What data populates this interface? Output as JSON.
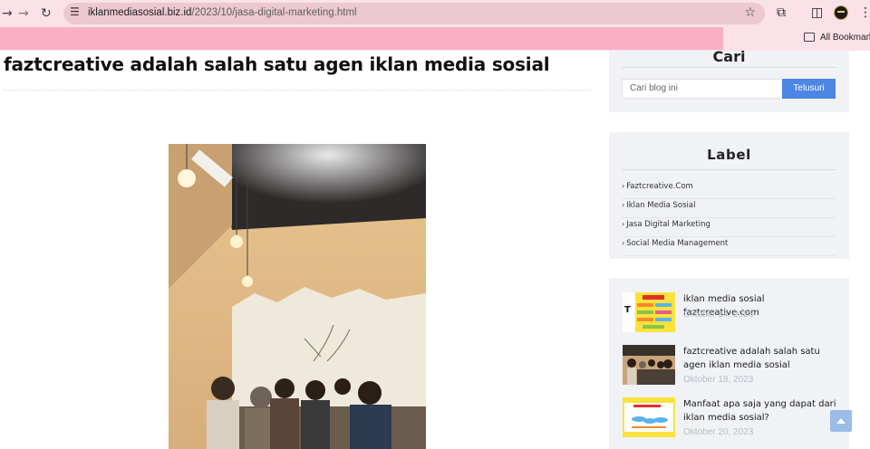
{
  "browser": {
    "url_host": "iklanmediasosial.biz.id",
    "url_path": "/2023/10/jasa-digital-marketing.html",
    "bookmarks_label": "All Bookmarks",
    "accent_banner_color": "#f9b0c6"
  },
  "post": {
    "title": "faztcreative adalah salah satu agen iklan media sosial"
  },
  "sidebar": {
    "search": {
      "title": "Cari",
      "placeholder": "Cari blog ini",
      "button_label": "Telusuri",
      "button_color": "#4d86e3"
    },
    "labels": {
      "title": "Label",
      "items": [
        "Faztcreative.Com",
        "Iklan Media Sosial",
        "Jasa Digital Marketing",
        "Social Media Management"
      ]
    },
    "popular_posts": [
      {
        "title": "iklan media sosial faztcreative.com",
        "date": "Oktober 14, 2023",
        "thumb": "infographic-thumbnail"
      },
      {
        "title": "faztcreative adalah salah satu agen iklan media sosial",
        "date": "Oktober 18, 2023",
        "thumb": "group-photo-thumbnail"
      },
      {
        "title": "Manfaat apa saja yang dapat dari iklan media sosial?",
        "date": "Oktober 20, 2023",
        "thumb": "map-thumbnail"
      }
    ]
  },
  "icons": {
    "back": "arrow-left-icon",
    "forward": "arrow-right-icon",
    "reload": "reload-icon",
    "site_settings": "tune-icon",
    "bookmark": "star-icon",
    "extensions": "puzzle-icon",
    "sidebar": "sidebar-icon",
    "menu": "kebab-menu-icon",
    "folder": "folder-icon",
    "back_to_top": "arrow-up-icon"
  }
}
